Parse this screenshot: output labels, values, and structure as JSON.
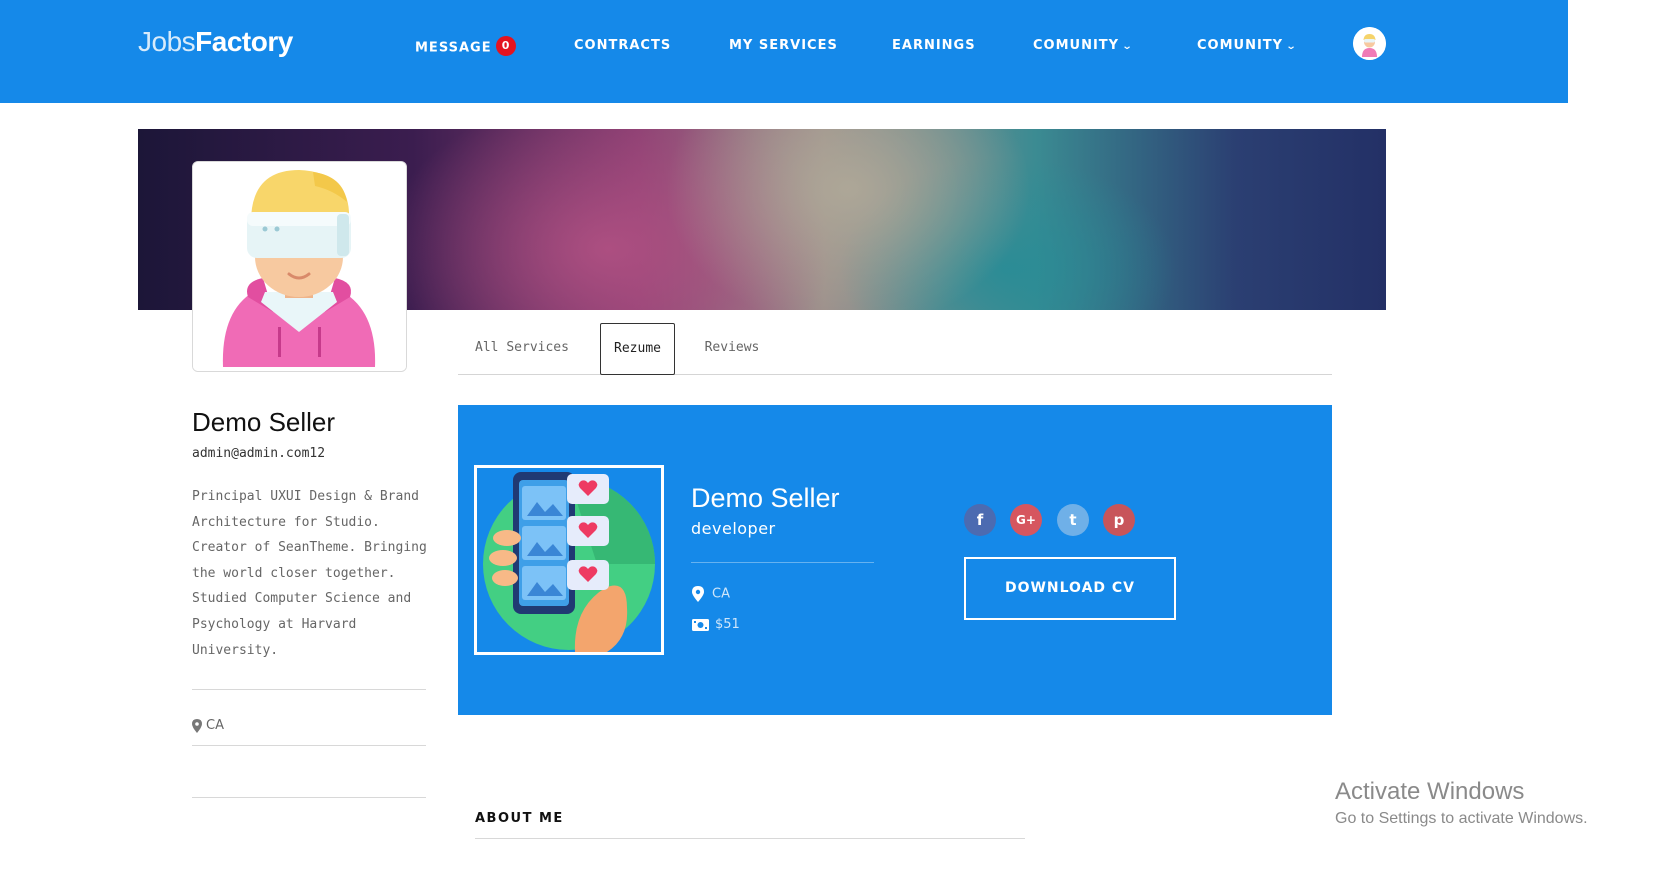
{
  "brand": {
    "part1": "Jobs",
    "part2": "Factory"
  },
  "nav": {
    "message_label": "MESSAGE",
    "message_count": "0",
    "contracts_label": "CONTRACTS",
    "my_services_label": "MY SERVICES",
    "earnings_label": "EARNINGS",
    "comunity1_label": "COMUNITY",
    "comunity2_label": "COMUNITY"
  },
  "tabs": [
    {
      "label": "All Services"
    },
    {
      "label": "Rezume",
      "active": true
    },
    {
      "label": "Reviews"
    }
  ],
  "profile": {
    "name": "Demo Seller",
    "email": "admin@admin.com12",
    "bio": "Principal UXUI Design & Brand Architecture for Studio. Creator of SeanTheme. Bringing the world closer together. Studied Computer Science and Psychology at Harvard University.",
    "location": "CA"
  },
  "resume": {
    "name": "Demo Seller",
    "role": "developer",
    "location": "CA",
    "rate": "$51",
    "download_label": "DOWNLOAD CV",
    "social": [
      {
        "icon": "facebook-icon",
        "glyph": "f",
        "color": "#4c6bb1"
      },
      {
        "icon": "google-plus-icon",
        "glyph": "G+",
        "color": "#d6565f"
      },
      {
        "icon": "twitter-icon",
        "glyph": "t",
        "color": "#6fb0e8"
      },
      {
        "icon": "pinterest-icon",
        "glyph": "p",
        "color": "#c8555a"
      }
    ]
  },
  "about": {
    "heading": "ABOUT ME"
  },
  "watermark": {
    "line1": "Activate Windows",
    "line2": "Go to Settings to activate Windows."
  },
  "colors": {
    "primary": "#1589e9",
    "badge": "#e4131f"
  }
}
